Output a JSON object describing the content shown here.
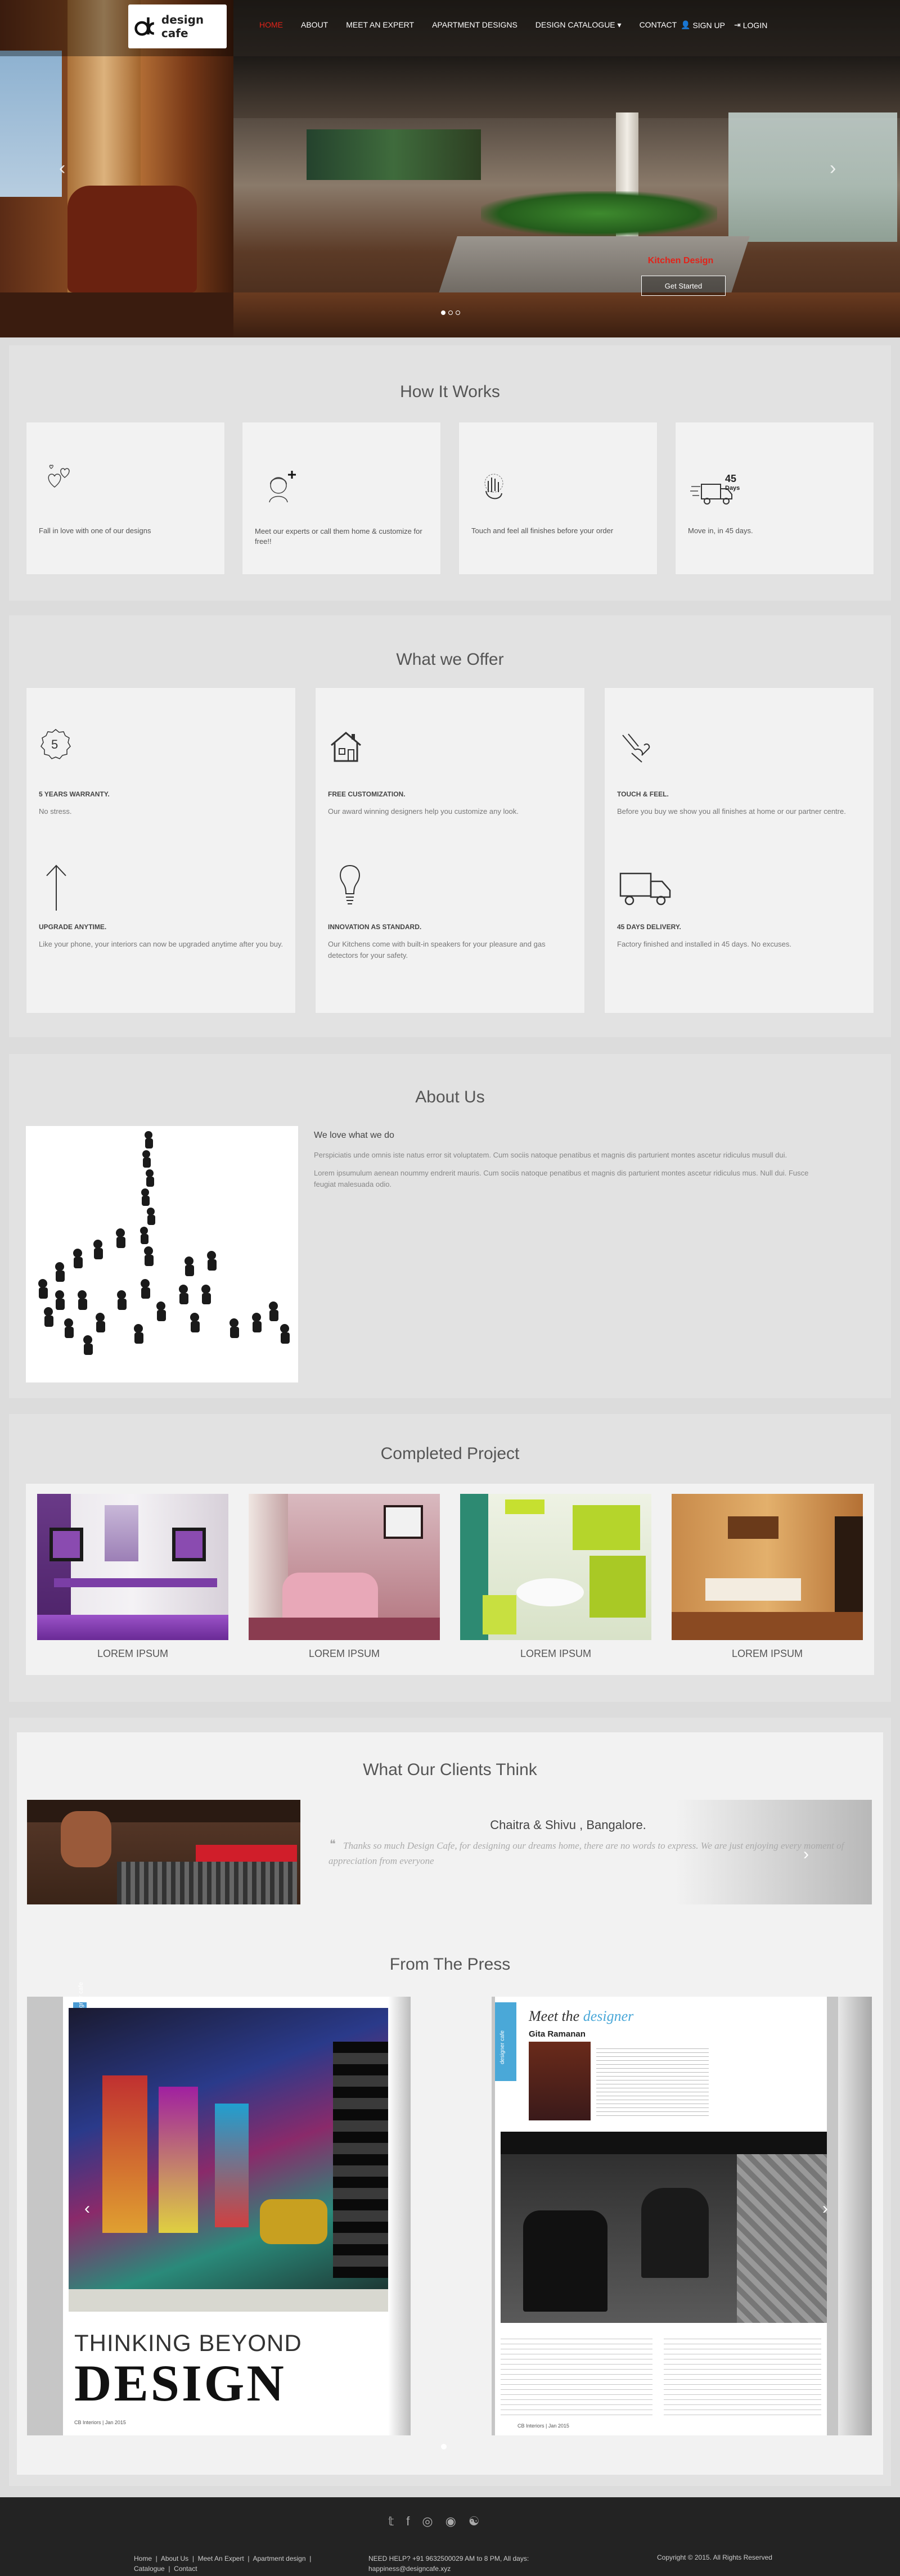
{
  "brand": {
    "name": "design cafe"
  },
  "nav": {
    "items": [
      {
        "label": "HOME",
        "active": true
      },
      {
        "label": "ABOUT"
      },
      {
        "label": "MEET AN EXPERT"
      },
      {
        "label": "APARTMENT DESIGNS"
      },
      {
        "label": "DESIGN CATALOGUE ▾"
      },
      {
        "label": "CONTACT"
      }
    ],
    "signup": "SIGN UP",
    "login": "LOGIN"
  },
  "hero": {
    "caption": "Kitchen Design",
    "button": "Get Started",
    "prev": "‹",
    "next": "›"
  },
  "how": {
    "title": "How It Works",
    "steps": [
      {
        "icon": "hearts-icon",
        "text": "Fall in love with one of our designs"
      },
      {
        "icon": "designer-plus-icon",
        "text": "Meet our experts or call them home & customize for free!!"
      },
      {
        "icon": "hand-touch-icon",
        "text": "Touch and feel all finishes before your order"
      },
      {
        "icon": "delivery-truck-icon",
        "text": "Move in, in 45 days."
      }
    ]
  },
  "offer": {
    "title": "What we Offer",
    "items": [
      {
        "icon": "badge-5-icon",
        "heading": "5 YEARS WARRANTY.",
        "text": "No stress."
      },
      {
        "icon": "house-icon",
        "heading": "FREE CUSTOMIZATION.",
        "text": "Our award winning designers help you customize any look."
      },
      {
        "icon": "hand-icon",
        "heading": "TOUCH & FEEL.",
        "text": "Before you buy we show you all finishes at home or our partner centre."
      },
      {
        "icon": "arrow-up-icon",
        "heading": "UPGRADE ANYTIME.",
        "text": "Like your phone, your interiors can now be upgraded anytime after you buy."
      },
      {
        "icon": "bulb-icon",
        "heading": "INNOVATION AS STANDARD.",
        "text": "Our Kitchens come with built-in speakers for your pleasure and gas detectors for your safety."
      },
      {
        "icon": "truck-icon",
        "heading": "45 DAYS DELIVERY.",
        "text": "Factory finished and installed in 45 days. No excuses."
      }
    ]
  },
  "about": {
    "title": "About Us",
    "subtitle": "We love what we do",
    "p1": "Perspiciatis unde omnis iste natus error sit voluptatem. Cum sociis natoque penatibus et magnis dis parturient montes ascetur ridiculus musull dui.",
    "p2": "Lorem ipsumulum aenean noummy endrerit mauris. Cum sociis natoque penatibus et magnis dis parturient montes ascetur ridiculus mus. Null dui. Fusce feugiat malesuada odio."
  },
  "projects": {
    "title": "Completed Project",
    "items": [
      {
        "label": "LOREM IPSUM"
      },
      {
        "label": "LOREM IPSUM"
      },
      {
        "label": "LOREM IPSUM"
      },
      {
        "label": "LOREM IPSUM"
      }
    ]
  },
  "clients": {
    "title": "What Our Clients Think",
    "name": "Chaitra & Shivu , Bangalore.",
    "quote": "Thanks so much Design Cafe, for designing our dreams home, there are no words to express. We are just enjoying every moment of appreciation from everyone",
    "open_quote": "❝"
  },
  "press": {
    "title": "From The Press",
    "left": {
      "tag": "designer cafe",
      "headline_small": "THINKING BEYOND",
      "headline_big": "DESIGN",
      "footer": "CB Interiors | Jan 2015"
    },
    "right": {
      "tag": "designer cafe",
      "heading_prefix": "Meet the",
      "heading_word": "designer",
      "name": "Gita Ramanan",
      "footer": "CB Interiors | Jan 2015"
    }
  },
  "footer": {
    "links": [
      "Home",
      "About Us",
      "Meet An Expert",
      "Apartment design",
      "Catalogue",
      "Contact"
    ],
    "help": "NEED HELP? +91 9632500029 AM to 8 PM, All days:",
    "email": "happiness@designcafe.xyz",
    "copyright": "Copyright © 2015. All Rights Reserved"
  }
}
